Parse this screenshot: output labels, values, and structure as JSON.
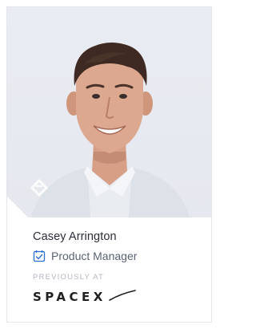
{
  "profile": {
    "name": "Casey Arrington",
    "role": "Product Manager",
    "previous_label": "PREVIOUSLY AT",
    "previous_company": "SPACEX"
  },
  "icons": {
    "brand_mark": "toptal-diamond-icon",
    "role_icon": "calendar-check-icon"
  },
  "colors": {
    "photo_background": "#e7eaf0",
    "accent_blue": "#2a6fd6",
    "name_text": "#2a2d38",
    "role_text": "#5a6273",
    "muted_label": "#b1b6c1"
  }
}
